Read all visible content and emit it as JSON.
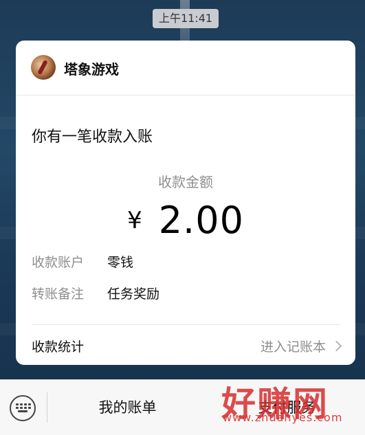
{
  "status": {
    "time": "上午11:41"
  },
  "card": {
    "app_name": "塔象游戏",
    "headline": "你有一笔收款入账",
    "amount_label": "收款金额",
    "currency_symbol": "¥",
    "amount": "2.00",
    "details": [
      {
        "key": "收款账户",
        "value": "零钱"
      },
      {
        "key": "转账备注",
        "value": "任务奖励"
      }
    ],
    "stats_label": "收款统计",
    "stats_link": "进入记账本"
  },
  "bottom_menu": {
    "item1": "我的账单",
    "item2": "支付服务"
  },
  "watermark": {
    "text": "好赚网",
    "url": "www.zhuanyes.com"
  }
}
